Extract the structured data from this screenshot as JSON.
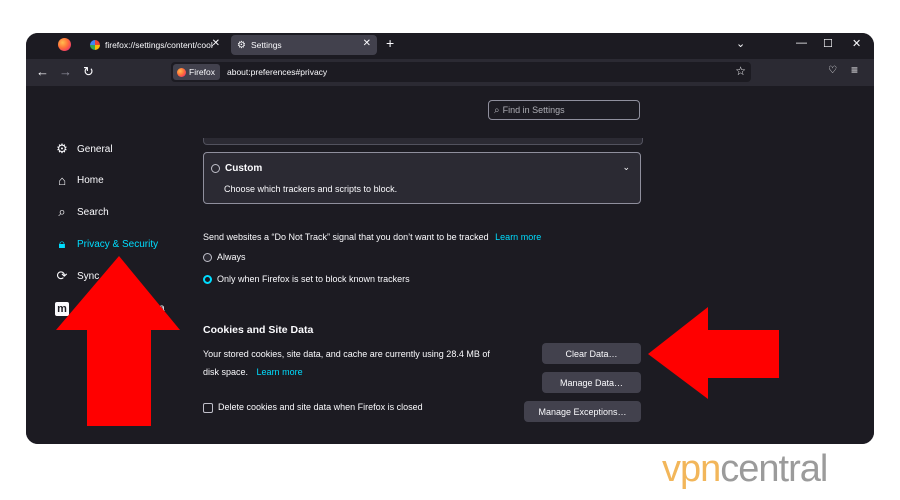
{
  "tabs": [
    {
      "title": "firefox://settings/content/cook",
      "active": false
    },
    {
      "title": "Settings",
      "active": true
    }
  ],
  "toolbar": {
    "identity_label": "Firefox",
    "url": "about:preferences#privacy"
  },
  "search": {
    "placeholder": "Find in Settings"
  },
  "sidebar": {
    "items": [
      {
        "label": "General",
        "icon": "gear-icon"
      },
      {
        "label": "Home",
        "icon": "home-icon"
      },
      {
        "label": "Search",
        "icon": "search-icon"
      },
      {
        "label": "Privacy & Security",
        "icon": "lock-icon",
        "active": true
      },
      {
        "label": "Sync",
        "icon": "sync-icon"
      },
      {
        "label": "a",
        "icon": "mozilla-m-icon"
      }
    ]
  },
  "tracking": {
    "custom_label": "Custom",
    "custom_desc": "Choose which trackers and scripts to block."
  },
  "dnt": {
    "text": "Send websites a “Do Not Track” signal that you don’t want to be tracked",
    "learn_more": "Learn more",
    "options": [
      {
        "label": "Always",
        "selected": false
      },
      {
        "label": "Only when Firefox is set to block known trackers",
        "selected": true
      }
    ]
  },
  "cookies": {
    "heading": "Cookies and Site Data",
    "desc_line1": "Your stored cookies, site data, and cache are currently using 28.4 MB of",
    "desc_line2": "disk space.",
    "learn_more": "Learn more",
    "clear_button": "Clear Data…",
    "manage_button": "Manage Data…",
    "exceptions_button": "Manage Exceptions…",
    "delete_checkbox": "Delete cookies and site data when Firefox is closed"
  },
  "brand": {
    "vpn": "vpn",
    "central": "central"
  },
  "colors": {
    "accent": "#00ddff",
    "arrow": "#ff0000",
    "background": "#1c1b22"
  }
}
